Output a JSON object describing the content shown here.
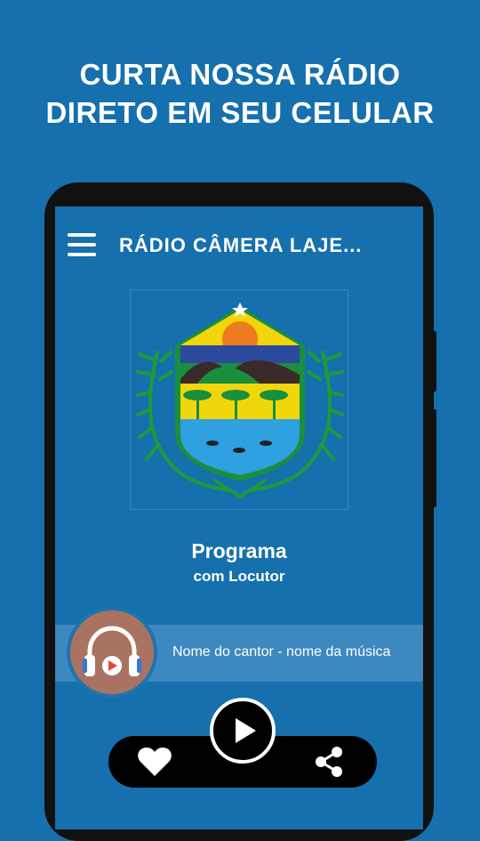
{
  "promo": {
    "line1": "CURTA NOSSA RÁDIO",
    "line2": "DIRETO EM SEU CELULAR"
  },
  "app": {
    "title": "RÁDIO CÂMERA LAJE..."
  },
  "program": {
    "title": "Programa",
    "subtitle": "com Locutor"
  },
  "now_playing": {
    "text": "Nome do cantor - nome da música"
  },
  "icons": {
    "menu": "hamburger-menu-icon",
    "logo": "coat-of-arms-logo",
    "avatar": "headphones-icon",
    "play": "play-icon",
    "favorite": "heart-icon",
    "share": "share-icon"
  },
  "colors": {
    "background": "#1570ad",
    "now_playing_bar": "#3d88bf",
    "avatar_bg": "#a87461",
    "controls": "#000000"
  }
}
